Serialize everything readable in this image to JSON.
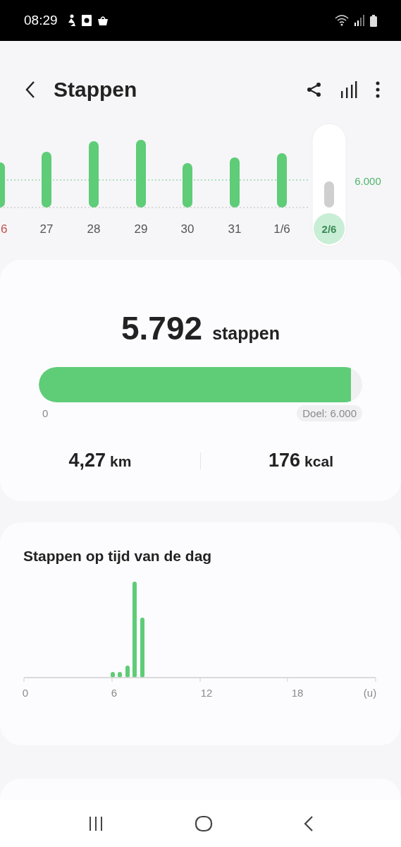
{
  "status_bar": {
    "time": "08:29"
  },
  "app_bar": {
    "title": "Stappen"
  },
  "week_chart": {
    "goal_label": "6.000",
    "days": [
      {
        "label": "6",
        "sunday": true,
        "selected": false
      },
      {
        "label": "27",
        "sunday": false,
        "selected": false
      },
      {
        "label": "28",
        "sunday": false,
        "selected": false
      },
      {
        "label": "29",
        "sunday": false,
        "selected": false
      },
      {
        "label": "30",
        "sunday": false,
        "selected": false
      },
      {
        "label": "31",
        "sunday": false,
        "selected": false
      },
      {
        "label": "1/6",
        "sunday": false,
        "selected": false
      },
      {
        "label": "2/6",
        "sunday": false,
        "selected": true
      }
    ]
  },
  "summary": {
    "steps": "5.792",
    "steps_unit": "stappen",
    "level": 0.965,
    "min_label": "0",
    "goal_label": "Doel: 6.000",
    "stats": [
      {
        "value": "4,27",
        "unit": "km"
      },
      {
        "value": "176",
        "unit": "kcal"
      }
    ]
  },
  "hourly": {
    "title": "Stappen op tijd van de dag",
    "ticks": [
      "0",
      "6",
      "12",
      "18",
      "(u)"
    ]
  }
}
